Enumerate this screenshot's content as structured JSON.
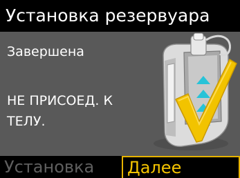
{
  "header": {
    "title": "Установка резервуара"
  },
  "main": {
    "status": "Завершена",
    "warning_line1": "НЕ ПРИСОЕД. К",
    "warning_line2": "ТЕЛУ.",
    "illustration_icon": "reservoir-inserted-check-icon"
  },
  "softkeys": {
    "left_label": "Установка",
    "right_label": "Далее"
  },
  "colors": {
    "background": "#595959",
    "bar": "#000000",
    "accent": "#f5c400",
    "disabled_text": "#5f5f5f",
    "text": "#ffffff"
  }
}
